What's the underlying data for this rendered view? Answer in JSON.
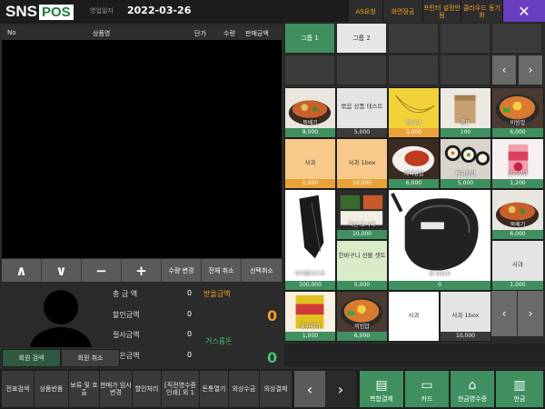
{
  "header": {
    "logo_sns": "SNS",
    "logo_pos": "POS",
    "biz_date_label": "영업일자",
    "biz_date": "2022-03-26",
    "buttons": [
      {
        "label": "AS요청"
      },
      {
        "label": "화면잠금"
      },
      {
        "label": "프린터 설정안됨"
      },
      {
        "label": "클라우드 동기화"
      }
    ],
    "close_glyph": "✕"
  },
  "item_list": {
    "columns": [
      "No",
      "상품명",
      "단가",
      "수량",
      "판매금액"
    ]
  },
  "controls": {
    "up": "∧",
    "down": "∨",
    "minus": "−",
    "plus": "+",
    "qty_change": "수량 변경",
    "cancel_all": "전체 취소",
    "cancel_selected": "선택취소"
  },
  "summary": {
    "total_label": "총 금 액",
    "total_value": "0",
    "discount_label": "할인금액",
    "discount_value": "0",
    "cut_label": "절사금액",
    "cut_value": "0",
    "received_label": "받은금액",
    "received_value": "0",
    "receivable_label": "받을금액",
    "receivable_value": "0",
    "change_label": "거스름돈",
    "change_value": "0"
  },
  "member": {
    "search": "회원 검색",
    "cancel": "회원 취소"
  },
  "function_bar": [
    {
      "label": "전표검색"
    },
    {
      "label": "상품반품"
    },
    {
      "label": "보류 및 호출"
    },
    {
      "label": "판매가 임시변경"
    },
    {
      "label": "할인처리"
    },
    {
      "label": "[직전영수증 인쇄] 외 1"
    },
    {
      "label": "돈통열기"
    },
    {
      "label": "외상수금"
    },
    {
      "label": "외상결제"
    }
  ],
  "nav": {
    "prev": "‹",
    "next": "›"
  },
  "payments": [
    {
      "label": "복합결제",
      "icon": "multi-pay-icon"
    },
    {
      "label": "카드",
      "icon": "card-icon"
    },
    {
      "label": "현금영수증",
      "icon": "bank-icon"
    },
    {
      "label": "현금",
      "icon": "cash-icon"
    }
  ],
  "groups": [
    {
      "label": "그룹 1",
      "selected": true
    },
    {
      "label": "그룹 2",
      "selected": false
    }
  ],
  "products": [
    {
      "name": "뚝배기",
      "price": "8,000",
      "image": "bowl-food"
    },
    {
      "name": "묶음 상품 테스트",
      "price": "5,000",
      "image": "none"
    },
    {
      "name": "바나나",
      "price": "3,000",
      "image": "banana"
    },
    {
      "name": "롱투",
      "price": "100",
      "image": "box"
    },
    {
      "name": "비빔밥",
      "price": "6,000",
      "image": "bibimbap"
    },
    {
      "name": "사과",
      "price": "1,000",
      "image": "none-orange"
    },
    {
      "name": "사과 1box",
      "price": "10,000",
      "image": "none-orange"
    },
    {
      "name": "제육덮밥",
      "price": "6,000",
      "image": "rice-bowl"
    },
    {
      "name": "참치김밥",
      "price": "5,000",
      "image": "kimbap"
    },
    {
      "name": "딸기우유",
      "price": "1,200",
      "image": "milk"
    },
    {
      "name": "타이틀리스트",
      "price": "100,000",
      "image": "golf-club"
    },
    {
      "name": "특선 도시락",
      "price": "10,000",
      "image": "lunchbox"
    },
    {
      "name": "한바구니 선물 셋트",
      "price": "5,000",
      "image": "none-green"
    },
    {
      "name": "핑 G420",
      "price": "0",
      "image": "driver"
    },
    {
      "name": "뚝배기",
      "price": "6,000",
      "image": "bowl-food"
    },
    {
      "name": "사과",
      "price": "1,000",
      "image": "none"
    },
    {
      "name": "꽃파래기",
      "price": "1,000",
      "image": "snack"
    },
    {
      "name": "비빔밥",
      "price": "6,000",
      "image": "bibimbap"
    },
    {
      "name": "사과",
      "price": "1,000",
      "image": "none-white"
    },
    {
      "name": "사과 1box",
      "price": "10,000",
      "image": "none"
    }
  ],
  "colors": {
    "accent_green": "#3f8f5f",
    "accent_orange": "#f0a020",
    "close_purple": "#6a3fbf"
  }
}
